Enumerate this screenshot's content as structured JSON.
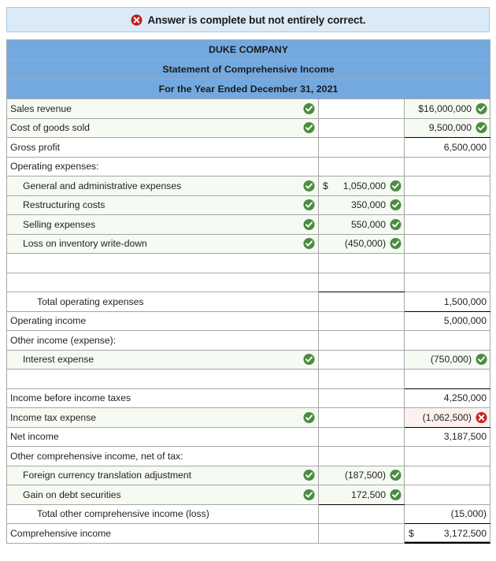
{
  "banner": {
    "icon": "error-circle-x-icon",
    "message": "Answer is complete but not entirely correct."
  },
  "statement": {
    "company": "DUKE COMPANY",
    "title": "Statement of Comprehensive Income",
    "period": "For the Year Ended December 31, 2021",
    "icons": {
      "correct": "check-circle-icon",
      "incorrect": "error-circle-x-icon"
    },
    "rows": [
      {
        "label": "Sales revenue",
        "indent": 0,
        "label_mark": "correct",
        "mid": "",
        "mid_mark": "",
        "right": "$16,000,000",
        "right_mark": "correct",
        "right_currency": ""
      },
      {
        "label": "Cost of goods sold",
        "indent": 0,
        "label_mark": "correct",
        "mid": "",
        "mid_mark": "",
        "right": "9,500,000",
        "right_mark": "correct",
        "right_rule": "sub-bot"
      },
      {
        "label": "Gross profit",
        "indent": 0,
        "label_mark": "",
        "mid": "",
        "mid_mark": "",
        "right": "6,500,000",
        "right_mark": ""
      },
      {
        "label": "Operating expenses:",
        "indent": 0,
        "label_mark": "",
        "mid": "",
        "mid_mark": "",
        "right": "",
        "right_mark": ""
      },
      {
        "label": "General and administrative expenses",
        "indent": 1,
        "label_mark": "correct",
        "mid": "1,050,000",
        "mid_mark": "correct",
        "mid_currency": "$",
        "right": "",
        "right_mark": ""
      },
      {
        "label": "Restructuring costs",
        "indent": 1,
        "label_mark": "correct",
        "mid": "350,000",
        "mid_mark": "correct",
        "right": "",
        "right_mark": ""
      },
      {
        "label": "Selling expenses",
        "indent": 1,
        "label_mark": "correct",
        "mid": "550,000",
        "mid_mark": "correct",
        "right": "",
        "right_mark": ""
      },
      {
        "label": "Loss on inventory write-down",
        "indent": 1,
        "label_mark": "correct",
        "mid": "(450,000)",
        "mid_mark": "correct",
        "right": "",
        "right_mark": ""
      },
      {
        "label": "",
        "indent": 0,
        "label_mark": "",
        "mid": "",
        "mid_mark": "",
        "right": "",
        "right_mark": ""
      },
      {
        "label": "",
        "indent": 0,
        "label_mark": "",
        "mid": "",
        "mid_mark": "",
        "right": "",
        "right_mark": "",
        "mid_rule": "sub-bot"
      },
      {
        "label": "Total operating expenses",
        "indent": 2,
        "label_mark": "",
        "mid": "",
        "mid_mark": "",
        "right": "1,500,000",
        "right_mark": "",
        "right_rule": "sub-bot"
      },
      {
        "label": "Operating income",
        "indent": 0,
        "label_mark": "",
        "mid": "",
        "mid_mark": "",
        "right": "5,000,000",
        "right_mark": ""
      },
      {
        "label": "Other income (expense):",
        "indent": 0,
        "label_mark": "",
        "mid": "",
        "mid_mark": "",
        "right": "",
        "right_mark": ""
      },
      {
        "label": "Interest expense",
        "indent": 1,
        "label_mark": "correct",
        "mid": "",
        "mid_mark": "",
        "right": "(750,000)",
        "right_mark": "correct"
      },
      {
        "label": "",
        "indent": 0,
        "label_mark": "",
        "mid": "",
        "mid_mark": "",
        "right": "",
        "right_mark": "",
        "right_rule": "sub-bot"
      },
      {
        "label": "Income before income taxes",
        "indent": 0,
        "label_mark": "",
        "mid": "",
        "mid_mark": "",
        "right": "4,250,000",
        "right_mark": ""
      },
      {
        "label": "Income tax expense",
        "indent": 0,
        "label_mark": "correct",
        "mid": "",
        "mid_mark": "",
        "right": "(1,062,500)",
        "right_mark": "incorrect",
        "right_rule": "sub-bot"
      },
      {
        "label": "Net income",
        "indent": 0,
        "label_mark": "",
        "mid": "",
        "mid_mark": "",
        "right": "3,187,500",
        "right_mark": ""
      },
      {
        "label": "Other comprehensive income, net of tax:",
        "indent": 0,
        "label_mark": "",
        "mid": "",
        "mid_mark": "",
        "right": "",
        "right_mark": ""
      },
      {
        "label": "Foreign currency translation adjustment",
        "indent": 1,
        "label_mark": "correct",
        "mid": "(187,500)",
        "mid_mark": "correct",
        "right": "",
        "right_mark": ""
      },
      {
        "label": "Gain on debt securities",
        "indent": 1,
        "label_mark": "correct",
        "mid": "172,500",
        "mid_mark": "correct",
        "right": "",
        "right_mark": "",
        "mid_rule": "sub-bot"
      },
      {
        "label": "Total other comprehensive income (loss)",
        "indent": 2,
        "label_mark": "",
        "mid": "",
        "mid_mark": "",
        "right": "(15,000)",
        "right_mark": "",
        "right_rule": "sub-bot"
      },
      {
        "label": "Comprehensive income",
        "indent": 0,
        "label_mark": "",
        "mid": "",
        "mid_mark": "",
        "right": "3,172,500",
        "right_mark": "",
        "right_currency": "$",
        "right_rule": "dbl-bot"
      }
    ]
  },
  "colors": {
    "header_blue": "#74a9e0",
    "banner_blue": "#dbeaf7",
    "correct_green": "#4c8c42",
    "incorrect_red": "#c3281e",
    "correct_cell_bg": "#f5faf3",
    "incorrect_cell_bg": "#fdf1ef"
  }
}
